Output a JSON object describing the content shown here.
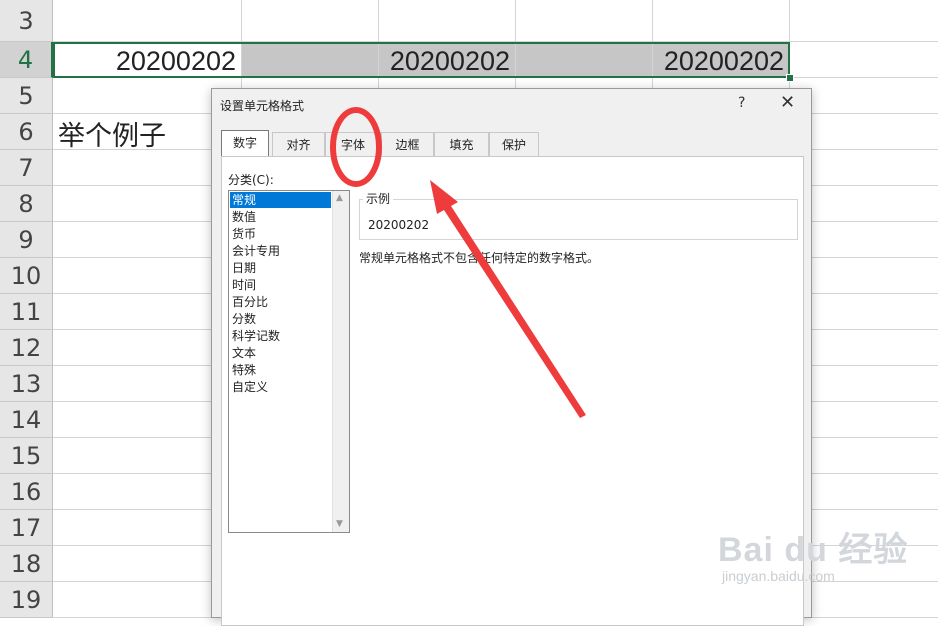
{
  "sheet": {
    "row_numbers": [
      "3",
      "4",
      "5",
      "6",
      "7",
      "8",
      "9",
      "10",
      "11",
      "12",
      "13",
      "14",
      "15",
      "16",
      "17",
      "18",
      "19"
    ],
    "row4_values": [
      "20200202",
      "20200202",
      "20200202"
    ],
    "row6_text": "举个例子"
  },
  "dialog": {
    "title": "设置单元格格式",
    "help": "?",
    "close": "✕",
    "tabs": [
      "数字",
      "对齐",
      "字体",
      "边框",
      "填充",
      "保护"
    ],
    "active_tab": "数字",
    "category_label": "分类(C):",
    "categories": [
      "常规",
      "数值",
      "货币",
      "会计专用",
      "日期",
      "时间",
      "百分比",
      "分数",
      "科学记数",
      "文本",
      "特殊",
      "自定义"
    ],
    "selected_category": "常规",
    "sample_label": "示例",
    "sample_value": "20200202",
    "description": "常规单元格格式不包含任何特定的数字格式。"
  },
  "colors": {
    "selection": "#217346",
    "annotation": "#ee3c3c",
    "list_selected": "#0078d7"
  },
  "watermark": {
    "brand": "Bai du 经验",
    "url": "jingyan.baidu.com"
  }
}
